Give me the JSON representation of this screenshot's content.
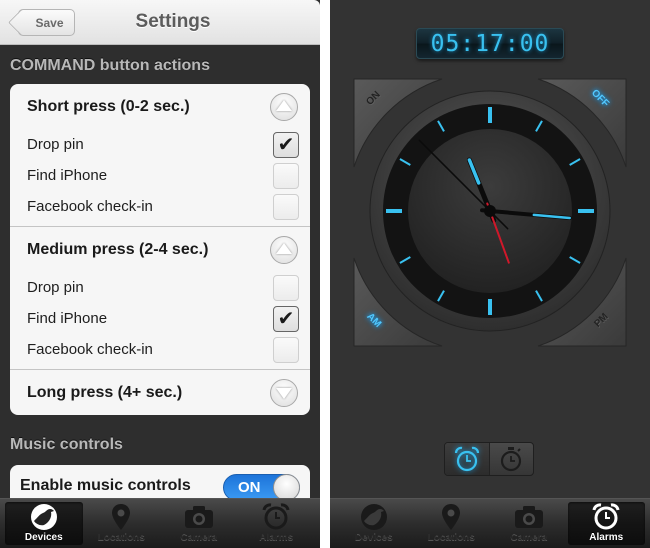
{
  "settings_screen": {
    "navbar": {
      "title": "Settings",
      "save_label": "Save"
    },
    "command_section": {
      "header": "COMMAND button actions",
      "groups": [
        {
          "title": "Short press (0-2 sec.)",
          "expanded": true,
          "toggle_icon": "chevron-up-icon",
          "options": [
            {
              "label": "Drop pin",
              "checked": true
            },
            {
              "label": "Find iPhone",
              "checked": false
            },
            {
              "label": "Facebook check-in",
              "checked": false
            }
          ]
        },
        {
          "title": "Medium press (2-4 sec.)",
          "expanded": true,
          "toggle_icon": "chevron-up-icon",
          "options": [
            {
              "label": "Drop pin",
              "checked": false
            },
            {
              "label": "Find iPhone",
              "checked": true
            },
            {
              "label": "Facebook check-in",
              "checked": false
            }
          ]
        },
        {
          "title": "Long press (4+ sec.)",
          "expanded": false,
          "toggle_icon": "chevron-down-icon",
          "options": []
        }
      ]
    },
    "music_section": {
      "header": "Music controls",
      "enable_label": "Enable music controls",
      "toggle_state": "ON",
      "toggle_on": true
    },
    "tabbar": {
      "active": "Devices",
      "tabs": [
        {
          "label": "Devices",
          "icon": "bird-icon"
        },
        {
          "label": "Locations",
          "icon": "map-pin-icon"
        },
        {
          "label": "Camera",
          "icon": "camera-icon"
        },
        {
          "label": "Alarms",
          "icon": "alarm-clock-icon"
        }
      ]
    }
  },
  "alarm_screen": {
    "digital_time": "05:17:00",
    "analog_time": {
      "hours": 5,
      "minutes": 17,
      "seconds": 26
    },
    "corner_buttons": {
      "on": {
        "label": "ON",
        "lit": false
      },
      "off": {
        "label": "OFF",
        "lit": true
      },
      "am": {
        "label": "AM",
        "lit": true
      },
      "pm": {
        "label": "PM",
        "lit": false
      }
    },
    "mode_switch": {
      "active": "alarm",
      "options": [
        {
          "name": "alarm",
          "icon": "alarm-clock-icon"
        },
        {
          "name": "timer",
          "icon": "stopwatch-icon"
        }
      ]
    },
    "accent_color": "#39c1f0",
    "second_hand_color": "#d0182a",
    "tabbar": {
      "active": "Alarms",
      "tabs": [
        {
          "label": "Devices",
          "icon": "bird-icon"
        },
        {
          "label": "Locations",
          "icon": "map-pin-icon"
        },
        {
          "label": "Camera",
          "icon": "camera-icon"
        },
        {
          "label": "Alarms",
          "icon": "alarm-clock-icon"
        }
      ]
    }
  }
}
